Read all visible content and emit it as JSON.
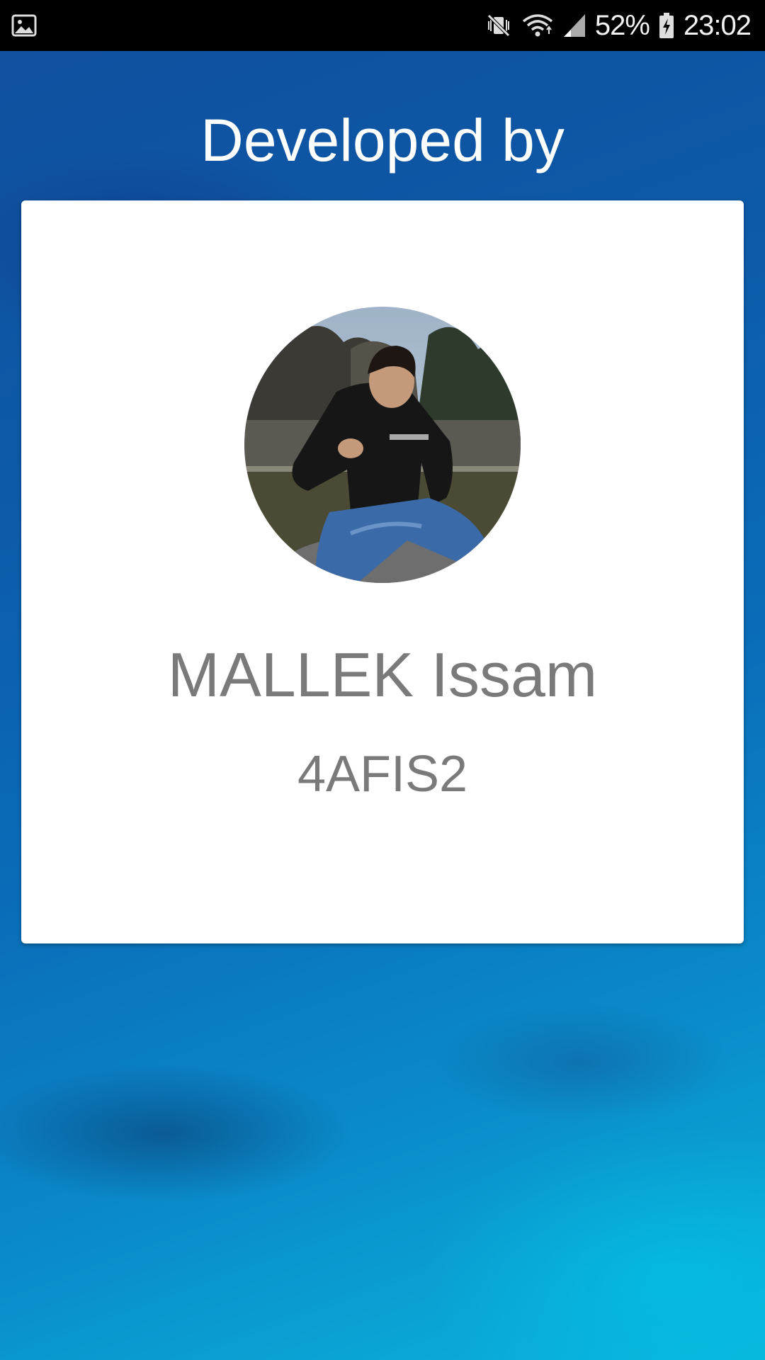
{
  "status_bar": {
    "left_icon": "image-notification-icon",
    "icons": [
      "mute-vibrate-icon",
      "wifi-icon",
      "signal-icon",
      "battery-charging-icon"
    ],
    "battery_percent": "52%",
    "time": "23:02"
  },
  "header": {
    "title": "Developed by"
  },
  "developer_card": {
    "avatar": "profile-photo",
    "name": "MALLEK Issam",
    "class": "4AFIS2"
  },
  "colors": {
    "status_bar_bg": "#000000",
    "card_bg": "#ffffff",
    "text_gray": "#7a7a7a",
    "heading_text": "#ffffff",
    "background_blue": "#0d5aa8"
  }
}
